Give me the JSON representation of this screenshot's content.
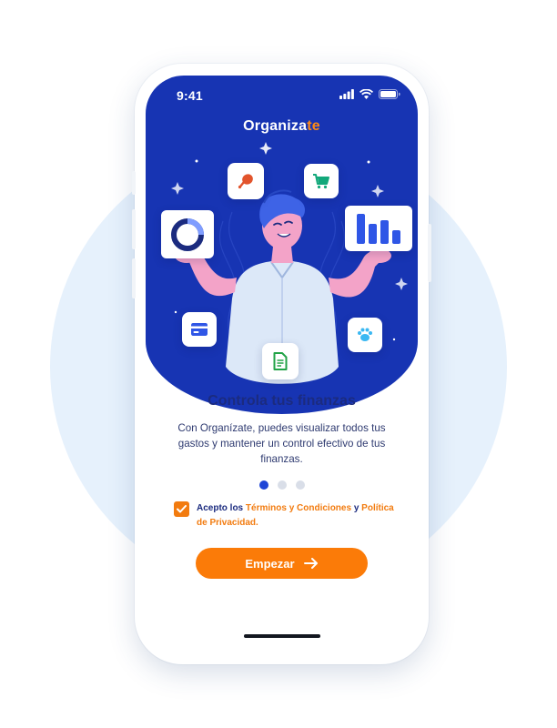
{
  "status_bar": {
    "time": "9:41"
  },
  "brand": {
    "name_main": "Organiza",
    "name_accent": "te"
  },
  "illustration": {
    "cards": [
      "chicken-leg-icon",
      "cart-icon",
      "donut-chart-icon",
      "bar-chart-icon",
      "credit-card-icon",
      "pet-paw-icon",
      "document-icon"
    ]
  },
  "onboarding": {
    "title": "Controla tus finanzas",
    "description": "Con Organízate, puedes visualizar todos tus gastos y mantener un control efectivo de tus finanzas.",
    "page_indicator": {
      "current": 1,
      "total": 3
    }
  },
  "terms": {
    "checked": true,
    "prefix": "Acepto los",
    "terms_link": "Términos y Condiciones",
    "conjunction": "y",
    "privacy_link": "Política de Privacidad."
  },
  "cta": {
    "label": "Empezar",
    "icon": "arrow-right-icon"
  },
  "colors": {
    "hero_blue": "#1734b3",
    "accent_orange": "#fb7b08",
    "title_navy": "#1b2b7f",
    "background_circle": "#e6f1fc"
  }
}
